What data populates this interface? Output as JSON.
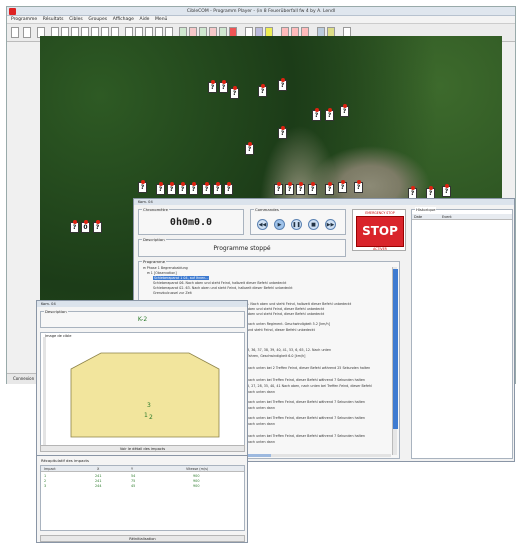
{
  "main_window": {
    "title": "CibleCOM - Programm Player - (in 8 Feuerüberfall fw 4 by A. Lendl",
    "menu": [
      "Programme",
      "Résultats",
      "Cibles",
      "Groupes",
      "Affichage",
      "Aide",
      "Menü"
    ],
    "status": "Connexion"
  },
  "map": {
    "marker_label": "?",
    "group_label": "0"
  },
  "control": {
    "window_title": "Kom. 04",
    "chrono_label": "Chronomètre",
    "chrono_value": "0h0m0.0",
    "commands_label": "Commandes",
    "buttons": [
      "◀◀",
      "▶",
      "❚❚",
      "■",
      "▶▶"
    ],
    "description_label": "Description",
    "description_value": "Programme stoppé",
    "stop_top": "EMERGENCY STOP",
    "stop_label": "STOP",
    "stop_bottom": "ACTIVER",
    "programme_label": "Programme",
    "programme_lines": [
      "⊟ Phase 1 Begrenzbaldung",
      "⊟ 1 [Observation]",
      "Schieberaparat 1 04, auf Ihnen...",
      "Schieberaparat 06. Nach oben und steht Feind, halbzeit dieser Befehl unbedeckt",
      "Schieberaparat 02. 63. Nach oben und steht Feind, halbzeit dieser Befehl unbedeckt",
      "Grenzbulcussel zur Zeit",
      "t. Nach oben und steht Feind, halbzeit dieser Befehl unbedeckt",
      "oben und steht Feind, dieser Befehl unbedeckt",
      "oben und steht Feind, dieser Befehl unbedeckt",
      "nach unten Regiment. Geschwindigkeit 5.2 [km/h]",
      "und steht Feind, dieser Befehl unbedeckt",
      "3, 36, 37, 38, 39, 40, 41, 53, 6, 65, 12. Nach unten",
      "Fahren, Geschwindigkeit 6.0 [km/h]",
      "nach unten bei 2 Treffen Feind, dieser Befehl während 25 Sekunden halten",
      "nach unten bei Treffen Feind, dieser Befehl während 7 Sekunden halten",
      "5, 27, 28, 35, 40, 41 Nach oben, nach unten bei Treffen Feind, dieser Befehl",
      "nach unten dann",
      "nach unten bei Treffen Feind, dieser Befehl während 7 Sekunden halten",
      "nach unten dann",
      "nach unten bei Treffen Feind, dieser Befehl während 7 Sekunden halten",
      "nach unten dann",
      "nach unten bei Treffen Feind, dieser Befehl während 7 Sekunden halten",
      "nach unten dann"
    ],
    "history_label": "Historique",
    "history_columns": [
      "Date",
      "Event"
    ]
  },
  "impact": {
    "window_title": "Kom. 04",
    "description_label": "Description",
    "description_value": "K-2",
    "image_label": "Image de cible",
    "impact_labels": [
      "3",
      "1",
      "2"
    ],
    "detail_button": "Voir le détail des impacts"
  },
  "recap": {
    "title": "Récapitulatif des impacts",
    "columns": [
      "Impact",
      "X",
      "Y",
      "Vitesse (m/s)"
    ],
    "rows": [
      [
        "1",
        "241",
        "54",
        "900"
      ],
      [
        "2",
        "241",
        "75",
        "900"
      ],
      [
        "3",
        "244",
        "45",
        "900"
      ]
    ],
    "button": "Réinitialisation"
  },
  "colors": {
    "stop_red": "#d9242b",
    "target_fill": "#f2e59d",
    "impact_green": "#2a7a2a",
    "scroll_blue": "#3e7bd1"
  }
}
